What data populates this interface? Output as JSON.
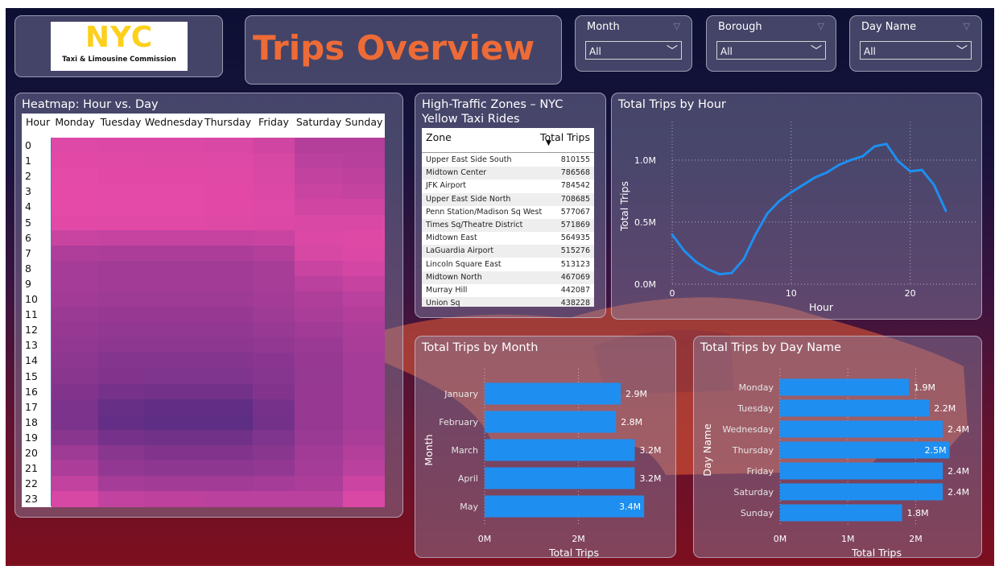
{
  "header": {
    "logo_text": "NYC",
    "logo_subtitle": "Taxi & Limousine Commission",
    "title": "Trips Overview"
  },
  "slicers": [
    {
      "label": "Month",
      "value": "All"
    },
    {
      "label": "Borough",
      "value": "All"
    },
    {
      "label": "Day Name",
      "value": "All"
    }
  ],
  "heatmap": {
    "title": "Heatmap: Hour vs. Day",
    "corner_label": "Hour",
    "days": [
      "Monday",
      "Tuesday",
      "Wednesday",
      "Thursday",
      "Friday",
      "Saturday",
      "Sunday"
    ],
    "hours": [
      "0",
      "1",
      "2",
      "3",
      "4",
      "5",
      "6",
      "7",
      "8",
      "9",
      "10",
      "11",
      "12",
      "13",
      "14",
      "15",
      "16",
      "17",
      "18",
      "19",
      "20",
      "21",
      "22",
      "23"
    ],
    "colors": {
      "low": "#e54aa8",
      "high": "#572b82"
    },
    "intensity": [
      [
        0.05,
        0.06,
        0.07,
        0.08,
        0.15,
        0.35,
        0.35
      ],
      [
        0.02,
        0.03,
        0.04,
        0.05,
        0.1,
        0.3,
        0.33
      ],
      [
        0.01,
        0.02,
        0.02,
        0.03,
        0.08,
        0.25,
        0.28
      ],
      [
        0.0,
        0.01,
        0.01,
        0.02,
        0.06,
        0.2,
        0.24
      ],
      [
        0.0,
        0.01,
        0.01,
        0.02,
        0.05,
        0.15,
        0.15
      ],
      [
        0.02,
        0.03,
        0.03,
        0.04,
        0.06,
        0.08,
        0.08
      ],
      [
        0.2,
        0.22,
        0.22,
        0.22,
        0.2,
        0.06,
        0.04
      ],
      [
        0.38,
        0.4,
        0.4,
        0.4,
        0.35,
        0.1,
        0.06
      ],
      [
        0.45,
        0.48,
        0.48,
        0.48,
        0.43,
        0.2,
        0.12
      ],
      [
        0.45,
        0.48,
        0.48,
        0.48,
        0.43,
        0.3,
        0.22
      ],
      [
        0.48,
        0.5,
        0.5,
        0.5,
        0.46,
        0.38,
        0.3
      ],
      [
        0.52,
        0.55,
        0.55,
        0.55,
        0.5,
        0.42,
        0.35
      ],
      [
        0.55,
        0.58,
        0.58,
        0.58,
        0.54,
        0.48,
        0.4
      ],
      [
        0.58,
        0.62,
        0.62,
        0.62,
        0.58,
        0.52,
        0.42
      ],
      [
        0.62,
        0.68,
        0.68,
        0.68,
        0.64,
        0.55,
        0.45
      ],
      [
        0.65,
        0.7,
        0.72,
        0.72,
        0.66,
        0.56,
        0.45
      ],
      [
        0.7,
        0.78,
        0.8,
        0.8,
        0.7,
        0.55,
        0.45
      ],
      [
        0.75,
        0.88,
        0.92,
        0.92,
        0.78,
        0.55,
        0.45
      ],
      [
        0.75,
        0.9,
        0.95,
        0.95,
        0.8,
        0.55,
        0.45
      ],
      [
        0.65,
        0.78,
        0.82,
        0.82,
        0.72,
        0.52,
        0.42
      ],
      [
        0.5,
        0.65,
        0.7,
        0.7,
        0.65,
        0.48,
        0.35
      ],
      [
        0.4,
        0.58,
        0.62,
        0.62,
        0.58,
        0.45,
        0.3
      ],
      [
        0.25,
        0.45,
        0.48,
        0.48,
        0.45,
        0.4,
        0.18
      ],
      [
        0.1,
        0.25,
        0.28,
        0.3,
        0.3,
        0.3,
        0.08
      ]
    ]
  },
  "zones": {
    "title": "High-Traffic Zones – NYC Yellow Taxi Rides",
    "columns": [
      "Zone",
      "Total Trips"
    ],
    "sort_icon": "sort-descending-icon",
    "rows": [
      {
        "zone": "Upper East Side South",
        "trips": "810155"
      },
      {
        "zone": "Midtown Center",
        "trips": "786568"
      },
      {
        "zone": "JFK Airport",
        "trips": "784542"
      },
      {
        "zone": "Upper East Side North",
        "trips": "708685"
      },
      {
        "zone": "Penn Station/Madison Sq West",
        "trips": "577067"
      },
      {
        "zone": "Times Sq/Theatre District",
        "trips": "571869"
      },
      {
        "zone": "Midtown East",
        "trips": "564935"
      },
      {
        "zone": "LaGuardia Airport",
        "trips": "515276"
      },
      {
        "zone": "Lincoln Square East",
        "trips": "513123"
      },
      {
        "zone": "Midtown North",
        "trips": "467069"
      },
      {
        "zone": "Murray Hill",
        "trips": "442087"
      },
      {
        "zone": "Union Sq",
        "trips": "438228"
      }
    ]
  },
  "chart_data": [
    {
      "type": "line",
      "title": "Total Trips by Hour",
      "xlabel": "Hour",
      "ylabel": "Total Trips",
      "x": [
        0,
        1,
        2,
        3,
        4,
        5,
        6,
        7,
        8,
        9,
        10,
        11,
        12,
        13,
        14,
        15,
        16,
        17,
        18,
        19,
        20,
        21,
        22,
        23
      ],
      "values": [
        0.4,
        0.27,
        0.18,
        0.12,
        0.08,
        0.09,
        0.2,
        0.4,
        0.57,
        0.67,
        0.74,
        0.8,
        0.86,
        0.9,
        0.96,
        1.0,
        1.03,
        1.11,
        1.13,
        0.99,
        0.91,
        0.92,
        0.8,
        0.59
      ],
      "value_unit": "millions",
      "xticks": [
        "0",
        "10",
        "20"
      ],
      "yticks": [
        "0.0M",
        "0.5M",
        "1.0M"
      ],
      "xlim": [
        0,
        23
      ],
      "ylim": [
        0,
        1.2
      ],
      "color": "#1e8ff0",
      "grid": true
    },
    {
      "type": "bar",
      "title": "Total Trips by Month",
      "xlabel": "Total Trips",
      "ylabel": "Month",
      "categories": [
        "January",
        "February",
        "March",
        "April",
        "May"
      ],
      "values": [
        2.9,
        2.8,
        3.2,
        3.2,
        3.4
      ],
      "labels": [
        "2.9M",
        "2.8M",
        "3.2M",
        "3.2M",
        "3.4M"
      ],
      "value_unit": "millions",
      "xticks": [
        "0M",
        "2M"
      ],
      "xlim": [
        0,
        3.5
      ],
      "color": "#1e8ff0",
      "grid": true
    },
    {
      "type": "bar",
      "title": "Total Trips by Day Name",
      "xlabel": "Total Trips",
      "ylabel": "Day Name",
      "categories": [
        "Monday",
        "Tuesday",
        "Wednesday",
        "Thursday",
        "Friday",
        "Saturday",
        "Sunday"
      ],
      "values": [
        1.9,
        2.2,
        2.4,
        2.5,
        2.4,
        2.4,
        1.8
      ],
      "labels": [
        "1.9M",
        "2.2M",
        "2.4M",
        "2.5M",
        "2.4M",
        "2.4M",
        "1.8M"
      ],
      "value_unit": "millions",
      "xticks": [
        "0M",
        "1M",
        "2M"
      ],
      "xlim": [
        0,
        2.6
      ],
      "color": "#1e8ff0",
      "grid": true
    }
  ]
}
